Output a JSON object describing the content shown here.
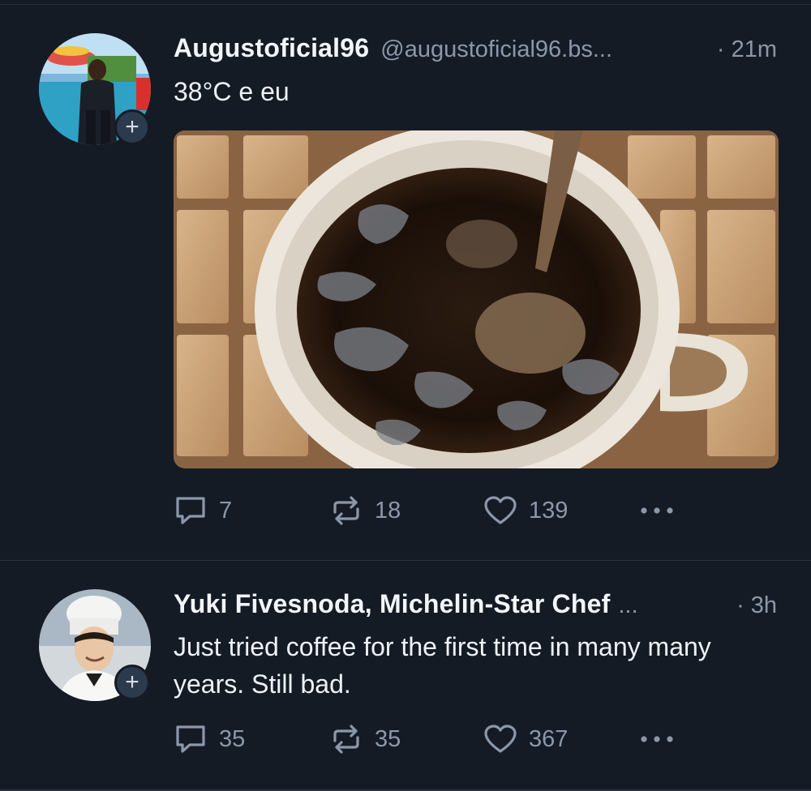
{
  "posts": [
    {
      "display_name": "Augustoficial96",
      "handle": "@augustoficial96.bs...",
      "separator": "·",
      "time": "21m",
      "text": "38°C e eu",
      "follow_icon": "plus-icon",
      "counts": {
        "replies": "7",
        "reposts": "18",
        "likes": "139"
      }
    },
    {
      "display_name": "Yuki Fivesnoda, Michelin-Star Chef",
      "name_ellipsis": "...",
      "separator": "·",
      "time": "3h",
      "text": "Just tried coffee for the first time in many many years. Still bad.",
      "follow_icon": "plus-icon",
      "counts": {
        "replies": "35",
        "reposts": "35",
        "likes": "367"
      }
    }
  ],
  "colors": {
    "background": "#151b25",
    "text_primary": "#eef2f7",
    "text_secondary": "#8b98a9",
    "divider": "#2a3240",
    "follow_button": "#2c3a4d"
  },
  "icons": {
    "reply": "speech-bubble-icon",
    "repost": "repost-arrows-icon",
    "like": "heart-icon",
    "more": "more-dots-icon"
  }
}
